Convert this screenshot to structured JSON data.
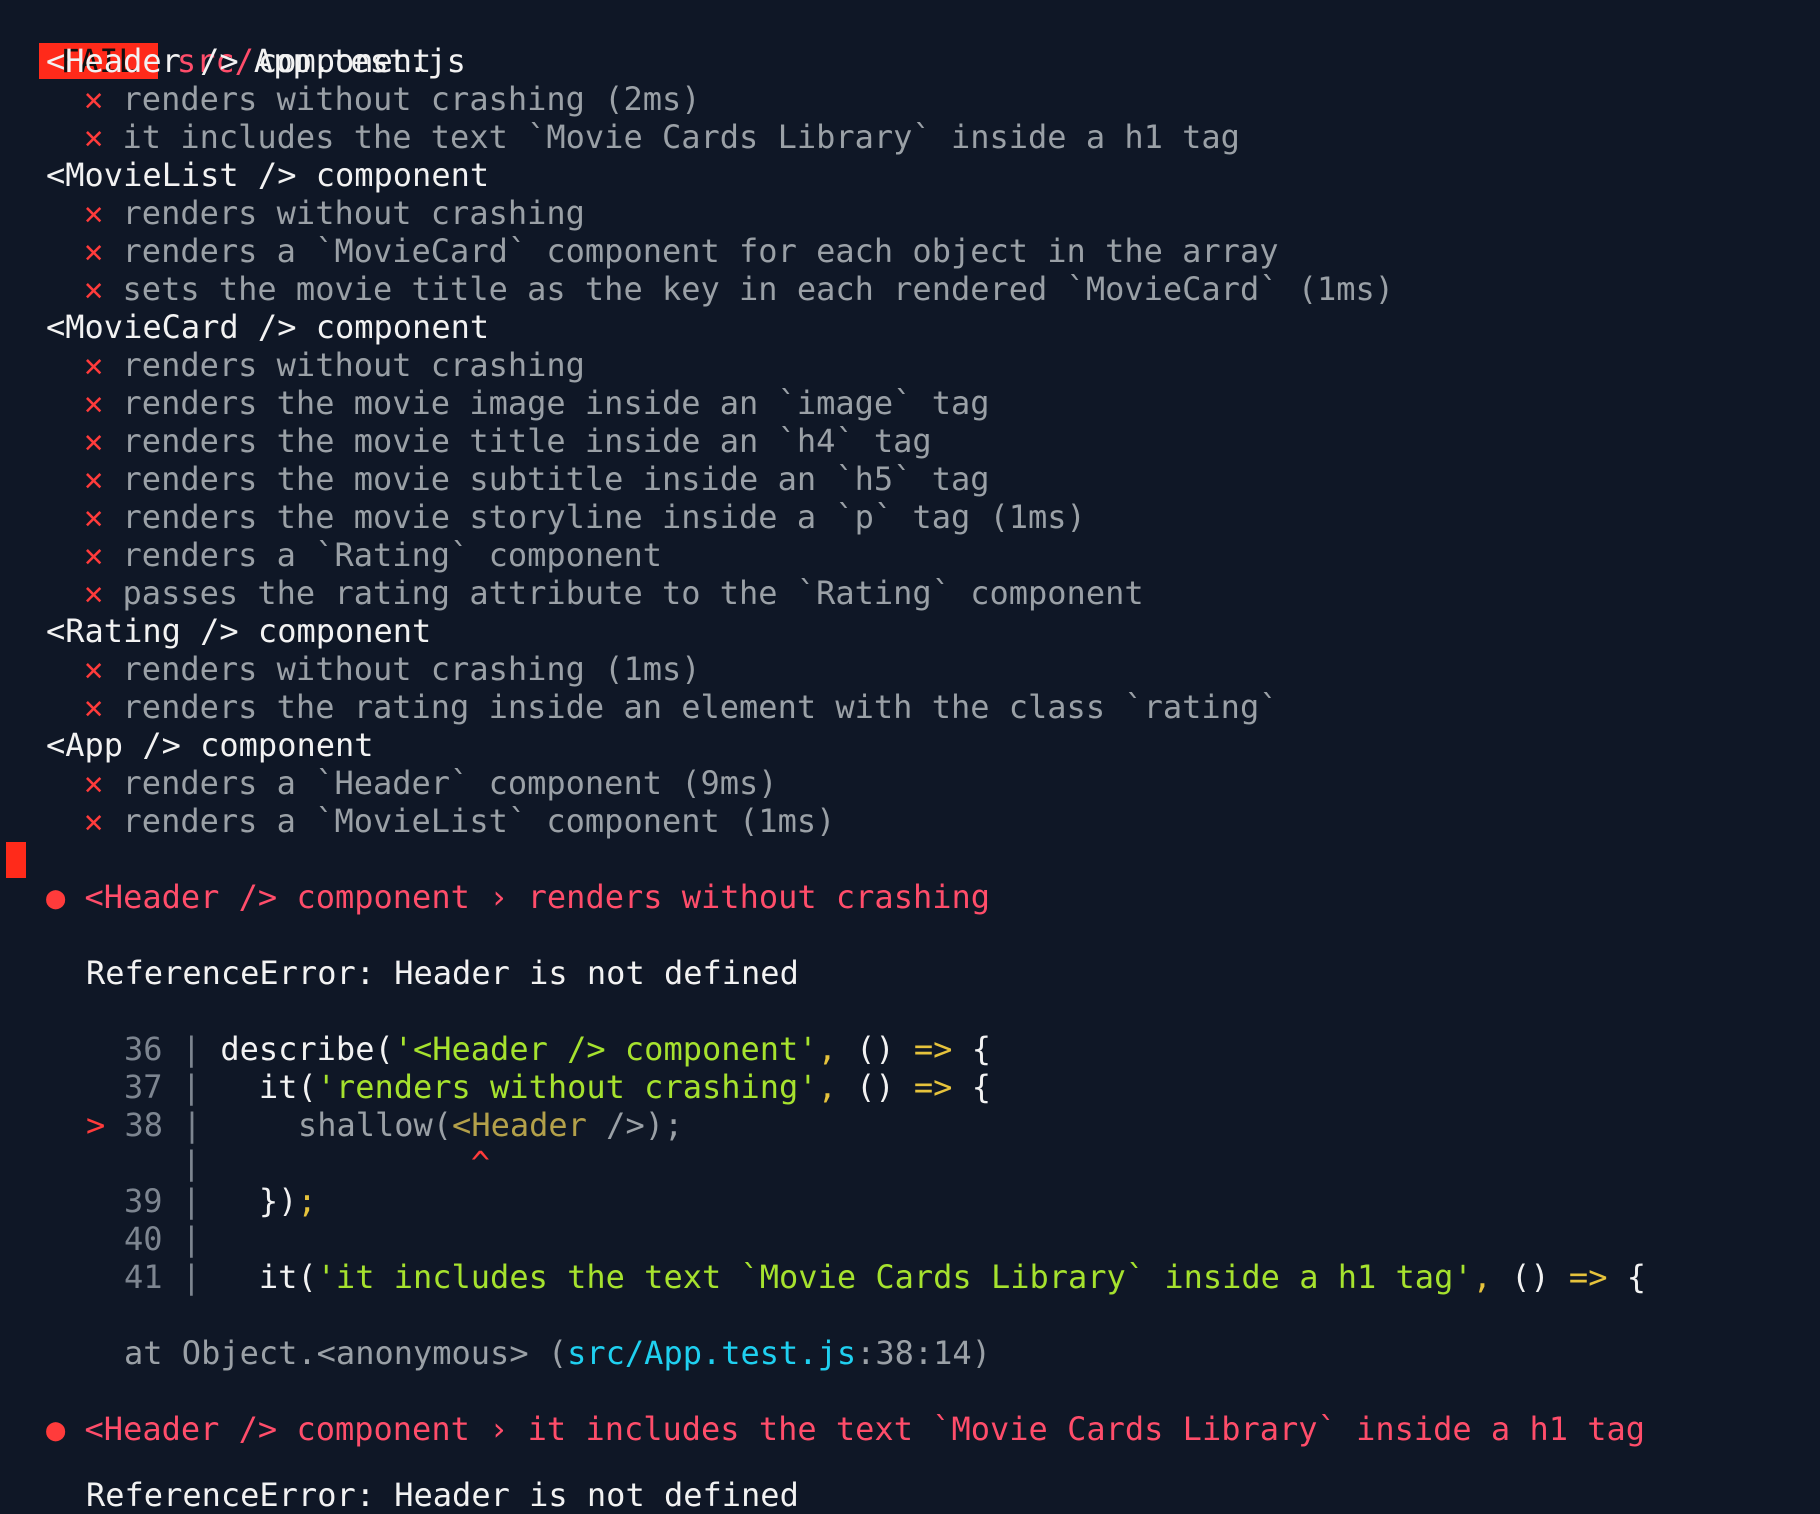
{
  "header": {
    "fail_badge": "FAIL",
    "path_prefix": "src/",
    "file": "App.test.js"
  },
  "cross_mark": "✕",
  "suites": [
    {
      "title": "<Header /> component",
      "tests": [
        "renders without crashing (2ms)",
        "it includes the text `Movie Cards Library` inside a h1 tag"
      ]
    },
    {
      "title": "<MovieList /> component",
      "tests": [
        "renders without crashing",
        "renders a `MovieCard` component for each object in the array",
        "sets the movie title as the key in each rendered `MovieCard` (1ms)"
      ]
    },
    {
      "title": "<MovieCard /> component",
      "tests": [
        "renders without crashing",
        "renders the movie image inside an `image` tag",
        "renders the movie title inside an `h4` tag",
        "renders the movie subtitle inside an `h5` tag",
        "renders the movie storyline inside a `p` tag (1ms)",
        "renders a `Rating` component",
        "passes the rating attribute to the `Rating` component"
      ]
    },
    {
      "title": "<Rating /> component",
      "tests": [
        "renders without crashing (1ms)",
        "renders the rating inside an element with the class `rating`"
      ]
    },
    {
      "title": "<App /> component",
      "tests": [
        "renders a `Header` component (9ms)",
        "renders a `MovieList` component (1ms)"
      ]
    }
  ],
  "failure1": {
    "bullet": "●",
    "heading": "<Header /> component › renders without crashing",
    "error": "ReferenceError: Header is not defined",
    "code": {
      "l36_num": "36",
      "l36_a": "describe(",
      "l36_str": "'<Header /> component'",
      "l36_comma": ",",
      "l36_b": " () ",
      "l36_arrow": "=>",
      "l36_c": " {",
      "l37_num": "37",
      "l37_a": "it(",
      "l37_str": "'renders without crashing'",
      "l37_comma": ",",
      "l37_b": " () ",
      "l37_arrow": "=>",
      "l37_c": " {",
      "l38_marker": ">",
      "l38_num": "38",
      "l38_a": "shallow(",
      "l38_jsx": "<Header",
      "l38_b": " />);",
      "caret": "^",
      "l39_num": "39",
      "l39_a": "})",
      "l39_semi": ";",
      "l40_num": "40",
      "l41_num": "41",
      "l41_a": "it(",
      "l41_str": "'it includes the text `Movie Cards Library` inside a h1 tag'",
      "l41_comma": ",",
      "l41_b": " () ",
      "l41_arrow": "=>",
      "l41_c": " {",
      "pipe": "|"
    },
    "stack_prefix": "at Object.<anonymous> (",
    "stack_file": "src/App.test.js",
    "stack_suffix": ":38:14)"
  },
  "failure2": {
    "bullet": "●",
    "heading": "<Header /> component › it includes the text `Movie Cards Library` inside a h1 tag",
    "error_partial": "ReferenceError: Header is not defined"
  }
}
